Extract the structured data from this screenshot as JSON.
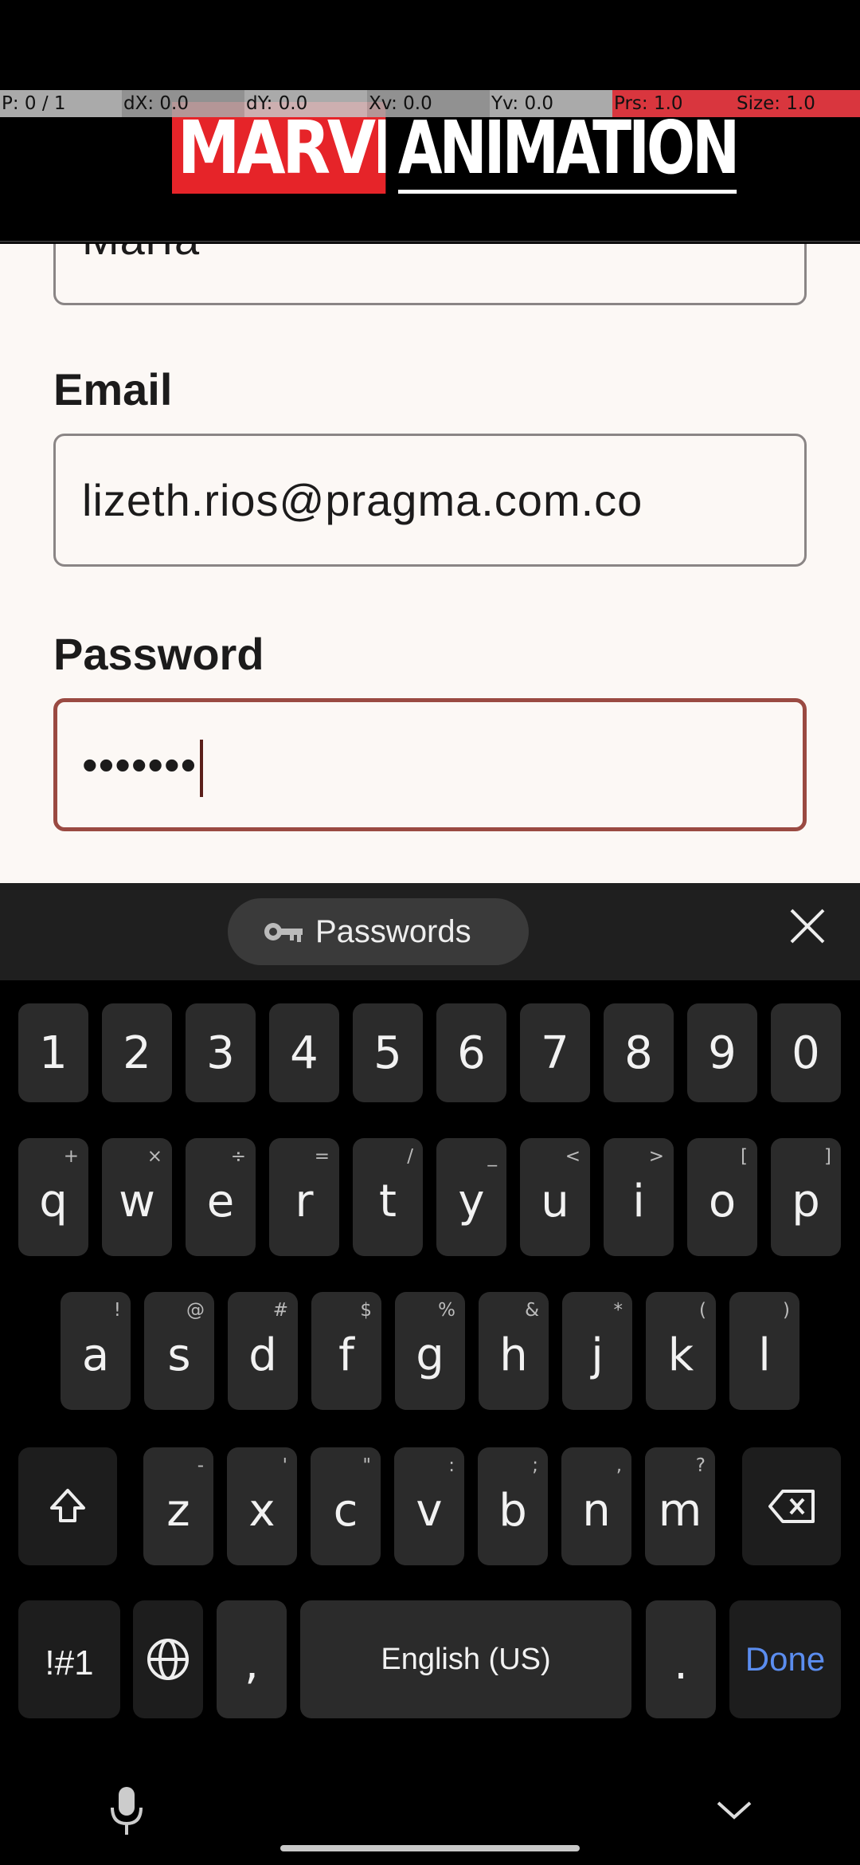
{
  "debug": {
    "p": "P: 0 / 1",
    "dx": "dX: 0.0",
    "dy": "dY: 0.0",
    "xv": "Xv: 0.0",
    "yv": "Yv: 0.0",
    "prs": "Prs: 1.0",
    "size": "Size: 1.0"
  },
  "header": {
    "logo_left": "MARVEL",
    "logo_right": "ANIMATION"
  },
  "form": {
    "name_value": "María",
    "email_label": "Email",
    "email_value": "lizeth.rios@pragma.com.co",
    "password_label": "Password",
    "password_value": "•••••••"
  },
  "keyboard": {
    "suggestion_chip": "Passwords",
    "number_row": [
      "1",
      "2",
      "3",
      "4",
      "5",
      "6",
      "7",
      "8",
      "9",
      "0"
    ],
    "row1": [
      {
        "k": "q",
        "s": "+"
      },
      {
        "k": "w",
        "s": "×"
      },
      {
        "k": "e",
        "s": "÷"
      },
      {
        "k": "r",
        "s": "="
      },
      {
        "k": "t",
        "s": "/"
      },
      {
        "k": "y",
        "s": "_"
      },
      {
        "k": "u",
        "s": "<"
      },
      {
        "k": "i",
        "s": ">"
      },
      {
        "k": "o",
        "s": "["
      },
      {
        "k": "p",
        "s": "]"
      }
    ],
    "row2": [
      {
        "k": "a",
        "s": "!"
      },
      {
        "k": "s",
        "s": "@"
      },
      {
        "k": "d",
        "s": "#"
      },
      {
        "k": "f",
        "s": "$"
      },
      {
        "k": "g",
        "s": "%"
      },
      {
        "k": "h",
        "s": "&"
      },
      {
        "k": "j",
        "s": "*"
      },
      {
        "k": "k",
        "s": "("
      },
      {
        "k": "l",
        "s": ")"
      }
    ],
    "row3": [
      {
        "k": "z",
        "s": "-"
      },
      {
        "k": "x",
        "s": "'"
      },
      {
        "k": "c",
        "s": "\""
      },
      {
        "k": "v",
        "s": ":"
      },
      {
        "k": "b",
        "s": ";"
      },
      {
        "k": "n",
        "s": ","
      },
      {
        "k": "m",
        "s": "?"
      }
    ],
    "symbols_label": "!#1",
    "comma_label": ",",
    "space_label": "English (US)",
    "period_label": ".",
    "done_label": "Done"
  },
  "colors": {
    "accent_done": "#5b8def",
    "focus_border": "#9a4a42",
    "marvel_red": "#e62429"
  }
}
